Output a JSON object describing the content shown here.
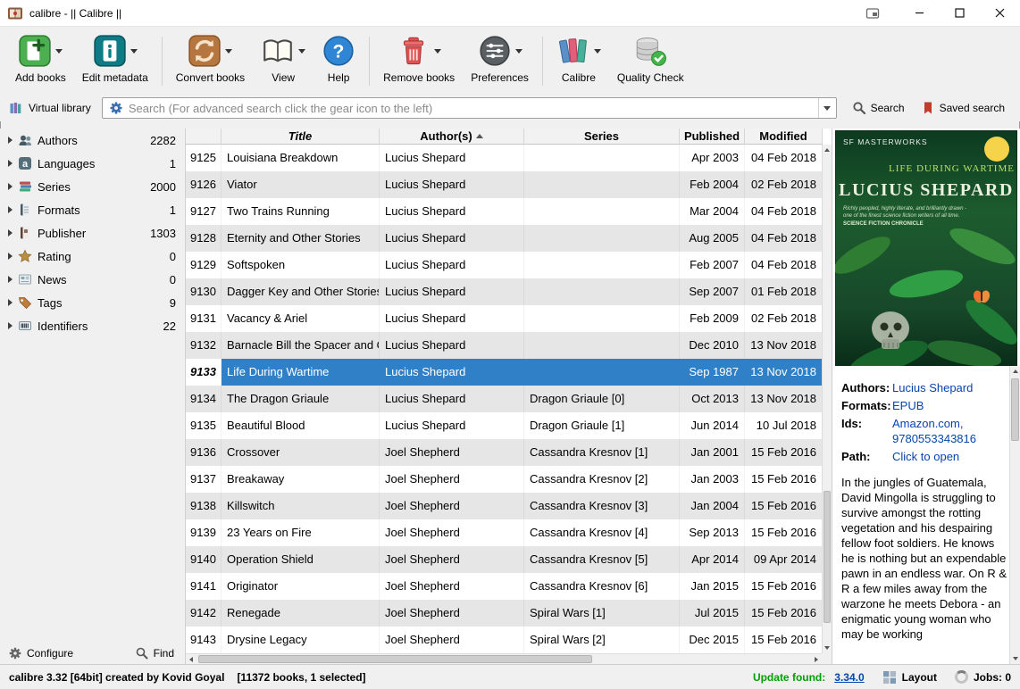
{
  "window": {
    "title": "calibre - || Calibre ||"
  },
  "colors": {
    "selection": "#3080c8",
    "link": "#0645ad",
    "update_green": "#00a000",
    "alt_row": "#e6e6e6"
  },
  "icons": {
    "help_glyph": "?",
    "languages_glyph": "a"
  },
  "toolbar": {
    "buttons": [
      {
        "label": "Add books"
      },
      {
        "label": "Edit metadata"
      },
      {
        "label": "Convert books"
      },
      {
        "label": "View"
      },
      {
        "label": "Help"
      },
      {
        "label": "Remove books"
      },
      {
        "label": "Preferences"
      },
      {
        "label": "Calibre"
      },
      {
        "label": "Quality Check"
      }
    ]
  },
  "searchbar": {
    "virtual_library": "Virtual library",
    "placeholder": "Search (For advanced search click the gear icon to the left)",
    "search_button": "Search",
    "saved_search_button": "Saved search"
  },
  "sidebar": {
    "items": [
      {
        "label": "Authors",
        "count": "2282"
      },
      {
        "label": "Languages",
        "count": "1"
      },
      {
        "label": "Series",
        "count": "2000"
      },
      {
        "label": "Formats",
        "count": "1"
      },
      {
        "label": "Publisher",
        "count": "1303"
      },
      {
        "label": "Rating",
        "count": "0"
      },
      {
        "label": "News",
        "count": "0"
      },
      {
        "label": "Tags",
        "count": "9"
      },
      {
        "label": "Identifiers",
        "count": "22"
      }
    ],
    "configure": "Configure",
    "find": "Find"
  },
  "table": {
    "columns": [
      "Title",
      "Author(s)",
      "Series",
      "Published",
      "Modified"
    ],
    "sorted_by": "Author(s)",
    "sort_direction": "ascending",
    "selected_id": "9133",
    "rows": [
      {
        "id": "9125",
        "title": "Louisiana Breakdown",
        "authors": "Lucius Shepard",
        "series": "",
        "published": "Apr 2003",
        "modified": "04 Feb 2018"
      },
      {
        "id": "9126",
        "title": "Viator",
        "authors": "Lucius Shepard",
        "series": "",
        "published": "Feb 2004",
        "modified": "02 Feb 2018"
      },
      {
        "id": "9127",
        "title": "Two Trains Running",
        "authors": "Lucius Shepard",
        "series": "",
        "published": "Mar 2004",
        "modified": "04 Feb 2018"
      },
      {
        "id": "9128",
        "title": "Eternity and Other Stories",
        "authors": "Lucius Shepard",
        "series": "",
        "published": "Aug 2005",
        "modified": "04 Feb 2018"
      },
      {
        "id": "9129",
        "title": "Softspoken",
        "authors": "Lucius Shepard",
        "series": "",
        "published": "Feb 2007",
        "modified": "04 Feb 2018"
      },
      {
        "id": "9130",
        "title": "Dagger Key and Other Stories",
        "authors": "Lucius Shepard",
        "series": "",
        "published": "Sep 2007",
        "modified": "01 Feb 2018"
      },
      {
        "id": "9131",
        "title": "Vacancy & Ariel",
        "authors": "Lucius Shepard",
        "series": "",
        "published": "Feb 2009",
        "modified": "02 Feb 2018"
      },
      {
        "id": "9132",
        "title": "Barnacle Bill the Spacer and Ot...",
        "authors": "Lucius Shepard",
        "series": "",
        "published": "Dec 2010",
        "modified": "13 Nov 2018"
      },
      {
        "id": "9133",
        "title": "Life During Wartime",
        "authors": "Lucius Shepard",
        "series": "",
        "published": "Sep 1987",
        "modified": "13 Nov 2018"
      },
      {
        "id": "9134",
        "title": "The Dragon Griaule",
        "authors": "Lucius Shepard",
        "series": "Dragon Griaule [0]",
        "published": "Oct 2013",
        "modified": "13 Nov 2018"
      },
      {
        "id": "9135",
        "title": "Beautiful Blood",
        "authors": "Lucius Shepard",
        "series": "Dragon Griaule [1]",
        "published": "Jun 2014",
        "modified": "10 Jul 2018"
      },
      {
        "id": "9136",
        "title": "Crossover",
        "authors": "Joel Shepherd",
        "series": "Cassandra Kresnov [1]",
        "published": "Jan 2001",
        "modified": "15 Feb 2016"
      },
      {
        "id": "9137",
        "title": "Breakaway",
        "authors": "Joel Shepherd",
        "series": "Cassandra Kresnov [2]",
        "published": "Jan 2003",
        "modified": "15 Feb 2016"
      },
      {
        "id": "9138",
        "title": "Killswitch",
        "authors": "Joel Shepherd",
        "series": "Cassandra Kresnov [3]",
        "published": "Jan 2004",
        "modified": "15 Feb 2016"
      },
      {
        "id": "9139",
        "title": "23 Years on Fire",
        "authors": "Joel Shepherd",
        "series": "Cassandra Kresnov [4]",
        "published": "Sep 2013",
        "modified": "15 Feb 2016"
      },
      {
        "id": "9140",
        "title": "Operation Shield",
        "authors": "Joel Shepherd",
        "series": "Cassandra Kresnov [5]",
        "published": "Apr 2014",
        "modified": "09 Apr 2014"
      },
      {
        "id": "9141",
        "title": "Originator",
        "authors": "Joel Shepherd",
        "series": "Cassandra Kresnov [6]",
        "published": "Jan 2015",
        "modified": "15 Feb 2016"
      },
      {
        "id": "9142",
        "title": "Renegade",
        "authors": "Joel Shepherd",
        "series": "Spiral Wars [1]",
        "published": "Jul 2015",
        "modified": "15 Feb 2016"
      },
      {
        "id": "9143",
        "title": "Drysine Legacy",
        "authors": "Joel Shepherd",
        "series": "Spiral Wars [2]",
        "published": "Dec 2015",
        "modified": "15 Feb 2016"
      }
    ]
  },
  "book_details": {
    "cover": {
      "imprint": "SF MASTERWORKS",
      "title": "LIFE DURING WARTIME",
      "author": "LUCIUS SHEPARD",
      "review_line1": "Richly peopled, highly literate, and brilliantly drawn -",
      "review_line2": "one of the finest science fiction writers of all time.",
      "review_source": "SCIENCE FICTION CHRONICLE"
    },
    "authors_label": "Authors:",
    "authors_value": "Lucius Shepard",
    "formats_label": "Formats:",
    "formats_value": "EPUB",
    "ids_label": "Ids:",
    "ids_value_line1": "Amazon.com,",
    "ids_value_line2": "9780553343816",
    "path_label": "Path:",
    "path_value": "Click to open",
    "description": "In the jungles of Guatemala, David Mingolla is struggling to survive amongst the rotting vegetation and his despairing fellow foot soldiers. He knows he is nothing but an expendable pawn in an endless war. On R & R a few miles away from the warzone he meets Debora - an enigmatic young woman who may be working"
  },
  "statusbar": {
    "app_info": "calibre 3.32 [64bit] created by Kovid Goyal",
    "books_info": "[11372 books, 1 selected]",
    "update_label": "Update found:",
    "update_version": "3.34.0",
    "layout_label": "Layout",
    "jobs_label": "Jobs: 0"
  }
}
